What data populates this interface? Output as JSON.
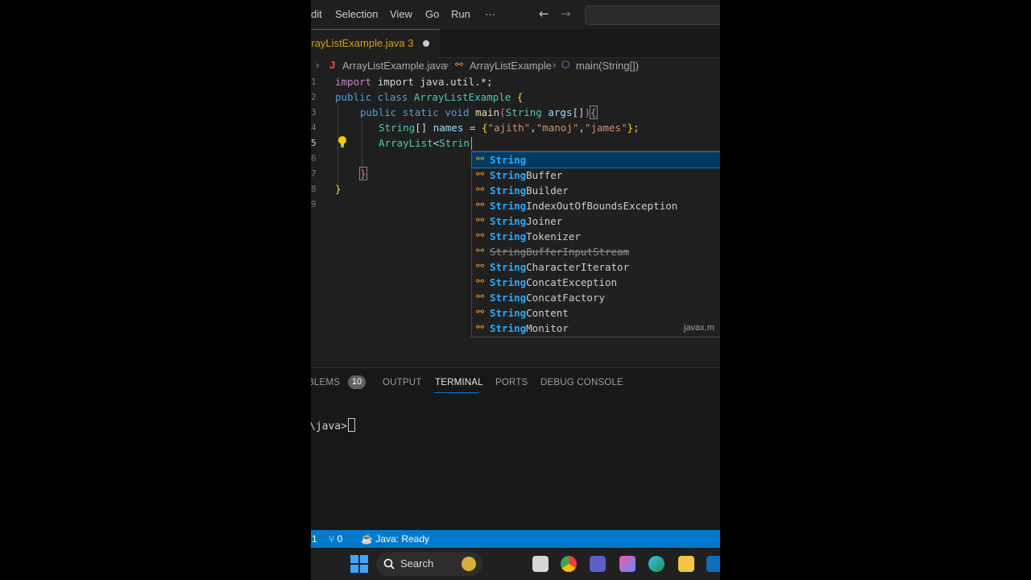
{
  "menubar": {
    "items": [
      "dit",
      "Selection",
      "View",
      "Go",
      "Run",
      "···"
    ],
    "back_glyph": "←",
    "forward_glyph": "→"
  },
  "tab": {
    "label": "rrayListExample.java",
    "problem_count": "3"
  },
  "breadcrumb": {
    "file": "ArrayListExample.java",
    "class": "ArrayListExample",
    "method": "main(String[])"
  },
  "editor": {
    "line_numbers": [
      "1",
      "2",
      "3",
      "4",
      "5",
      "6",
      "7",
      "8",
      "9"
    ],
    "line1": "import java.util.*;",
    "line3_kw": "public static void",
    "line3_fn": "main",
    "line3_param": "String",
    "line3_var": "args",
    "line4_type": "String",
    "line4_var": "names",
    "line4_s1": "\"ajith\"",
    "line4_s2": "\"manoj\"",
    "line4_s3": "\"james\"",
    "line5_type": "ArrayList",
    "line5_typed": "Strin"
  },
  "suggestions": [
    {
      "match": "String",
      "rest": "",
      "deprecated": false,
      "detail": ""
    },
    {
      "match": "String",
      "rest": "Buffer",
      "deprecated": false,
      "detail": ""
    },
    {
      "match": "String",
      "rest": "Builder",
      "deprecated": false,
      "detail": ""
    },
    {
      "match": "String",
      "rest": "IndexOutOfBoundsException",
      "deprecated": false,
      "detail": ""
    },
    {
      "match": "String",
      "rest": "Joiner",
      "deprecated": false,
      "detail": ""
    },
    {
      "match": "String",
      "rest": "Tokenizer",
      "deprecated": false,
      "detail": ""
    },
    {
      "match": "String",
      "rest": "BufferInputStream",
      "deprecated": true,
      "detail": ""
    },
    {
      "match": "String",
      "rest": "CharacterIterator",
      "deprecated": false,
      "detail": ""
    },
    {
      "match": "String",
      "rest": "ConcatException",
      "deprecated": false,
      "detail": ""
    },
    {
      "match": "String",
      "rest": "ConcatFactory",
      "deprecated": false,
      "detail": ""
    },
    {
      "match": "String",
      "rest": "Content",
      "deprecated": false,
      "detail": ""
    },
    {
      "match": "String",
      "rest": "Monitor",
      "deprecated": false,
      "detail": "javax.m"
    }
  ],
  "panel": {
    "tabs": [
      "BLEMS",
      "OUTPUT",
      "TERMINAL",
      "PORTS",
      "DEBUG CONSOLE"
    ],
    "problems_badge": "10",
    "active_tab": "TERMINAL",
    "terminal_prompt": "\\java>"
  },
  "statusbar": {
    "errors": "1",
    "ports": "0",
    "java_status": "Java: Ready"
  },
  "taskbar": {
    "search_label": "Search"
  },
  "colors": {
    "accent": "#007acc",
    "selection": "#04395e",
    "warning": "#cca700"
  }
}
